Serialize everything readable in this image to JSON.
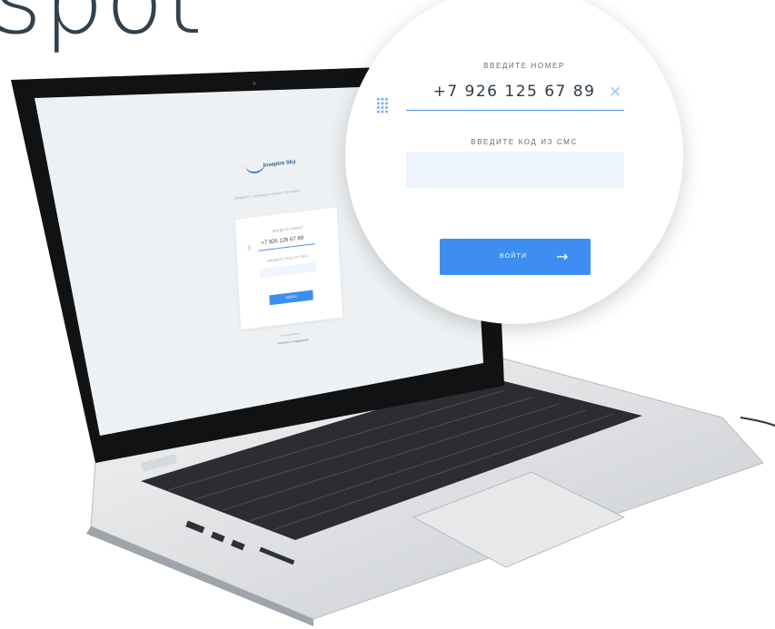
{
  "headline": "spot",
  "screen": {
    "logo": "Inseptra Sky",
    "tagline": "Войдите с помощью номера телефона",
    "phone_label": "ВВЕДИТЕ НОМЕР",
    "phone_value": "+7 926 125 67 89",
    "code_label": "ВВЕДИТЕ КОД ИЗ СМС",
    "button_label": "ВОЙТИ",
    "footer_text": "Нужна помощь?",
    "footer_link": "Связаться с поддержкой"
  },
  "magnifier": {
    "phone_label": "ВВЕДИТЕ НОМЕР",
    "phone_value": "+7 926 125 67 89",
    "clear_icon": "×",
    "code_label": "ВВЕДИТЕ КОД ИЗ СМС",
    "code_value": "",
    "button_label": "ВОЙТИ",
    "button_arrow": "→"
  },
  "colors": {
    "accent": "#3e8ef1",
    "input_bg": "#eef5fd",
    "text": "#2f3a45"
  }
}
